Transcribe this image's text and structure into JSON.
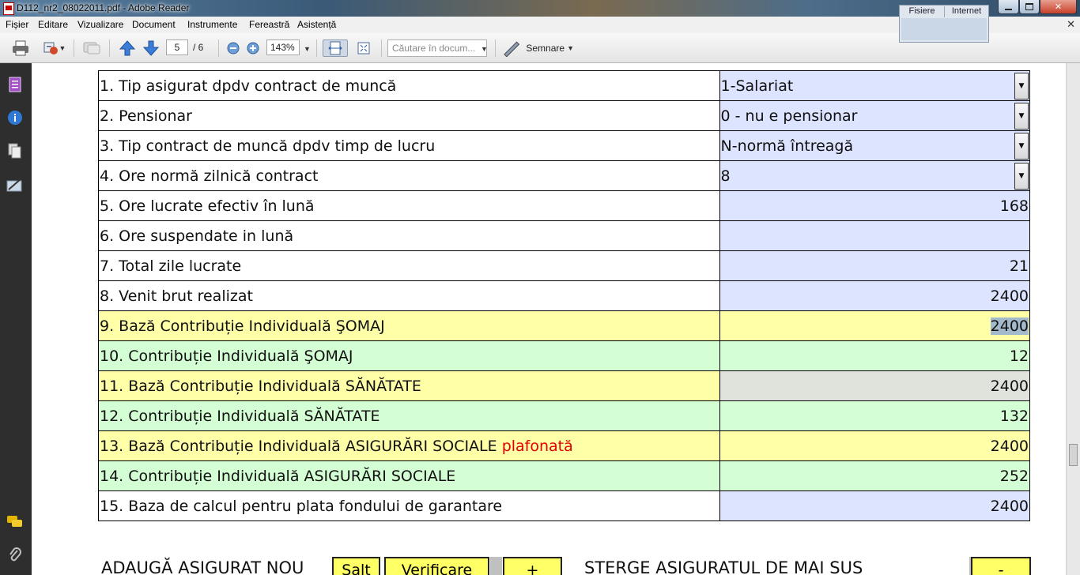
{
  "window": {
    "title": "D112_nr2_08022011.pdf - Adobe Reader",
    "close_glyph": "✕"
  },
  "share_panel": {
    "tabs": [
      "Fisiere",
      "Internet"
    ]
  },
  "menu": {
    "items": [
      "Fișier",
      "Editare",
      "Vizualizare",
      "Document",
      "Instrumente",
      "Fereastră",
      "Asistență"
    ],
    "close_glyph": "✕"
  },
  "toolbar": {
    "page_current": "5",
    "page_total": "/ 6",
    "zoom": "143%",
    "search_placeholder": "Căutare în docum...",
    "sign_label": "Semnare"
  },
  "form": {
    "rows": [
      {
        "label": "1. Tip asigurat dpdv contract de muncă",
        "value": "1-Salariat",
        "kind": "select",
        "bg": "#dde4ff"
      },
      {
        "label": "2. Pensionar",
        "value": "0 - nu e pensionar",
        "kind": "select",
        "bg": "#dde4ff"
      },
      {
        "label": "3. Tip contract de muncă dpdv timp de lucru",
        "value": "N-normă întreagă",
        "kind": "select",
        "bg": "#dde4ff"
      },
      {
        "label": "4. Ore normă zilnică contract",
        "value": "8",
        "kind": "select",
        "bg": "#dde4ff"
      },
      {
        "label": "5. Ore lucrate efectiv în lună",
        "value": "168",
        "kind": "field",
        "bg": "#dde4ff"
      },
      {
        "label": "6. Ore suspendate in lună",
        "value": "",
        "kind": "field",
        "bg": "#dde4ff"
      },
      {
        "label": "7. Total zile lucrate",
        "value": "21",
        "kind": "field",
        "bg": "#dde4ff"
      },
      {
        "label": "8. Venit brut realizat",
        "value": "2400",
        "kind": "field",
        "bg": "#dde4ff"
      },
      {
        "label": "9. Bază Contribuție Individuală ŞOMAJ",
        "value": "2400",
        "kind": "field",
        "bg": "#ffffa8",
        "label_bg": "#ffffa8",
        "selected": true
      },
      {
        "label": "10. Contribuție Individuală ŞOMAJ",
        "value": "12",
        "kind": "field",
        "bg": "#d4ffd4",
        "label_bg": "#d4ffd4"
      },
      {
        "label": "11. Bază Contribuție Individuală SĂNĂTATE",
        "value": "2400",
        "kind": "field",
        "bg": "#dfe3dc",
        "label_bg": "#ffffa8"
      },
      {
        "label": "12. Contribuție Individuală SĂNĂTATE",
        "value": "132",
        "kind": "field",
        "bg": "#d4ffd4",
        "label_bg": "#d4ffd4"
      },
      {
        "label": "13. Bază Contribuție Individuală ASIGURĂRI SOCIALE",
        "label_suffix": "plafonată",
        "value": "2400",
        "kind": "field",
        "bg": "#ffffa8",
        "label_bg": "#ffffa8"
      },
      {
        "label": "14. Contribuție Individuală ASIGURĂRI SOCIALE",
        "value": "252",
        "kind": "field",
        "bg": "#d4ffd4",
        "label_bg": "#d4ffd4"
      },
      {
        "label": "15. Baza de calcul pentru plata fondului de garantare",
        "value": "2400",
        "kind": "field",
        "bg": "#dde4ff"
      }
    ]
  },
  "bottom": {
    "add_label": "ADAUGĂ ASIGURAT NOU",
    "salt_label": "Salt",
    "verify_label": "Verificare",
    "plus_label": "+",
    "delete_label": "STERGE ASIGURATUL DE MAI SUS",
    "minus_label": "-"
  }
}
